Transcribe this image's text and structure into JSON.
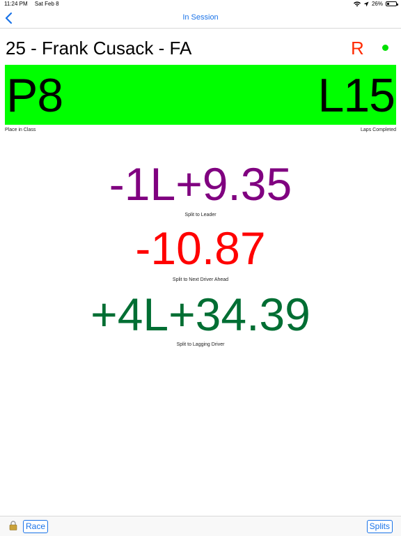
{
  "status_bar": {
    "time": "11:24 PM",
    "date": "Sat Feb 8",
    "battery": "26%",
    "battery_level": 0.26
  },
  "nav": {
    "title": "In Session",
    "back_icon": "chevron-left-icon"
  },
  "driver": {
    "name": "25 - Frank Cusack - FA",
    "flag": "R",
    "status_color": "#00e000"
  },
  "position_bar": {
    "place": "P8",
    "laps": "L15",
    "place_label": "Place in Class",
    "laps_label": "Laps Completed",
    "background": "#00ff00"
  },
  "splits": {
    "leader": {
      "value": "-1L+9.35",
      "label": "Split to Leader",
      "color": "#800080"
    },
    "ahead": {
      "value": "-10.87",
      "label": "Split to Next Driver Ahead",
      "color": "#ff0000"
    },
    "lagging": {
      "value": "+4L+34.39",
      "label": "Split to Lagging Driver",
      "color": "#006e33"
    }
  },
  "toolbar": {
    "lock_icon": "lock-icon",
    "race_label": "Race",
    "splits_label": "Splits"
  }
}
